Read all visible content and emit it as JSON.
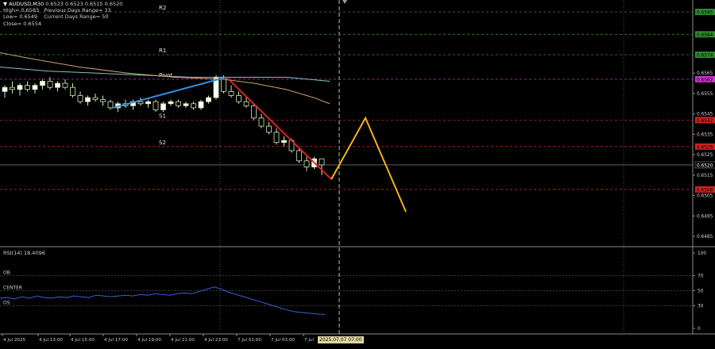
{
  "info": {
    "symbol": "AUDUSD,M30",
    "ohlc": "0.6523 0.6523 0.6515 0.6520",
    "high": "High= 0.6583",
    "prev_range": "Previous Days Range= 33",
    "low": "Low= 0.6549",
    "curr_range": "Current Days Range= 50",
    "close": "Close= 0.6554"
  },
  "levels": [
    {
      "label": "R2",
      "price": 0.6595,
      "tag": "0.6595",
      "color": "#2e8b2e"
    },
    {
      "label": "",
      "price": 0.6584,
      "tag": "0.6584",
      "color": "#2e8b2e"
    },
    {
      "label": "R1",
      "price": 0.6574,
      "tag": "0.6574",
      "color": "#2e8b2e"
    },
    {
      "label": "Pivot",
      "price": 0.6562,
      "tag": "0.6562",
      "color": "#cc33cc"
    },
    {
      "label": "S1",
      "price": 0.6542,
      "tag": "0.6542",
      "color": "#cc2222"
    },
    {
      "label": "S2",
      "price": 0.6529,
      "tag": "0.6529",
      "color": "#cc2222"
    },
    {
      "label": "",
      "price": 0.6508,
      "tag": "0.6508",
      "color": "#cc2222"
    }
  ],
  "price_ticks": [
    "0.6565",
    "0.6555",
    "0.6545",
    "0.6535",
    "0.6525",
    "0.6515",
    "0.6505",
    "0.6495",
    "0.6485"
  ],
  "last_price": {
    "price": 0.652,
    "tag": "0.6520"
  },
  "rsi": {
    "label": "RSI(14) 18.4096",
    "ticks": [
      "100",
      "70",
      "50",
      "30",
      "0"
    ],
    "levels": [
      {
        "name": "OB",
        "value": 70
      },
      {
        "name": "CENTER",
        "value": 50
      },
      {
        "name": "OS",
        "value": 30
      }
    ],
    "values": [
      40,
      41,
      39,
      42,
      40,
      43,
      41,
      40,
      42,
      41,
      43,
      42,
      41,
      44,
      43,
      42,
      43,
      44,
      43,
      45,
      44,
      46,
      45,
      44,
      46,
      47,
      46,
      49,
      52,
      55,
      52,
      48,
      45,
      42,
      39,
      36,
      33,
      30,
      27,
      24,
      22,
      21,
      20,
      19,
      18.4
    ]
  },
  "time_labels": [
    "4 Jul 2025",
    "4 Jul 13:00",
    "4 Jul 15:00",
    "4 Jul 17:00",
    "4 Jul 19:00",
    "4 Jul 21:00",
    "4 Jul 23:00",
    "7 Jul 01:00",
    "7 Jul 03:00",
    "7 Jul"
  ],
  "current_time_tag": "2025.07.07 07:00",
  "candles": [
    [
      0.6556,
      0.6559,
      0.6553,
      0.6558
    ],
    [
      0.6558,
      0.6561,
      0.6555,
      0.6557
    ],
    [
      0.6557,
      0.656,
      0.6554,
      0.6559
    ],
    [
      0.6559,
      0.6561,
      0.6556,
      0.6557
    ],
    [
      0.6557,
      0.656,
      0.6555,
      0.6559
    ],
    [
      0.6559,
      0.6562,
      0.6557,
      0.6561
    ],
    [
      0.6561,
      0.6563,
      0.6557,
      0.6558
    ],
    [
      0.6558,
      0.6561,
      0.6556,
      0.656
    ],
    [
      0.656,
      0.6562,
      0.6557,
      0.6558
    ],
    [
      0.6558,
      0.656,
      0.6553,
      0.6554
    ],
    [
      0.6554,
      0.6556,
      0.655,
      0.6551
    ],
    [
      0.6551,
      0.6554,
      0.6549,
      0.6553
    ],
    [
      0.6553,
      0.6555,
      0.6551,
      0.6552
    ],
    [
      0.6552,
      0.6554,
      0.6549,
      0.6551
    ],
    [
      0.6551,
      0.6552,
      0.6547,
      0.6548
    ],
    [
      0.6548,
      0.6551,
      0.6546,
      0.655
    ],
    [
      0.655,
      0.6552,
      0.6548,
      0.6549
    ],
    [
      0.6549,
      0.6552,
      0.6547,
      0.6551
    ],
    [
      0.6551,
      0.6553,
      0.6549,
      0.655
    ],
    [
      0.655,
      0.6552,
      0.6548,
      0.6551
    ],
    [
      0.6551,
      0.6552,
      0.6546,
      0.6547
    ],
    [
      0.6547,
      0.6551,
      0.6546,
      0.655
    ],
    [
      0.655,
      0.6552,
      0.6549,
      0.6551
    ],
    [
      0.6551,
      0.6552,
      0.6548,
      0.6549
    ],
    [
      0.6549,
      0.6551,
      0.6548,
      0.655
    ],
    [
      0.655,
      0.6551,
      0.6547,
      0.6548
    ],
    [
      0.6548,
      0.6552,
      0.6547,
      0.6551
    ],
    [
      0.6551,
      0.6554,
      0.655,
      0.6553
    ],
    [
      0.6553,
      0.6564,
      0.6552,
      0.6563
    ],
    [
      0.6563,
      0.6564,
      0.6555,
      0.6556
    ],
    [
      0.6556,
      0.6559,
      0.6553,
      0.6554
    ],
    [
      0.6554,
      0.6556,
      0.655,
      0.6551
    ],
    [
      0.6551,
      0.6553,
      0.6548,
      0.6549
    ],
    [
      0.6549,
      0.655,
      0.6542,
      0.6543
    ],
    [
      0.6543,
      0.6545,
      0.6538,
      0.6539
    ],
    [
      0.6539,
      0.6541,
      0.6535,
      0.6536
    ],
    [
      0.6536,
      0.6538,
      0.653,
      0.6531
    ],
    [
      0.6531,
      0.6534,
      0.6529,
      0.6532
    ],
    [
      0.6532,
      0.6533,
      0.6526,
      0.6527
    ],
    [
      0.6527,
      0.6528,
      0.6521,
      0.6522
    ],
    [
      0.6522,
      0.6524,
      0.6517,
      0.6519
    ],
    [
      0.6519,
      0.6524,
      0.6518,
      0.6523
    ],
    [
      0.6523,
      0.6523,
      0.6515,
      0.652
    ]
  ],
  "colors": {
    "grid": "#4a4a4a",
    "bull_body": "#ffffff",
    "bear_body": "#000000",
    "candle_line": "#cfe8b0",
    "ma_fast": "#7fc6c0",
    "ma_slow": "#c8a46a",
    "trend_up": "#2f8fe0",
    "trend_down": "#e02020",
    "projection": "#f5b21a",
    "rsi_line": "#3a5fd0"
  }
}
